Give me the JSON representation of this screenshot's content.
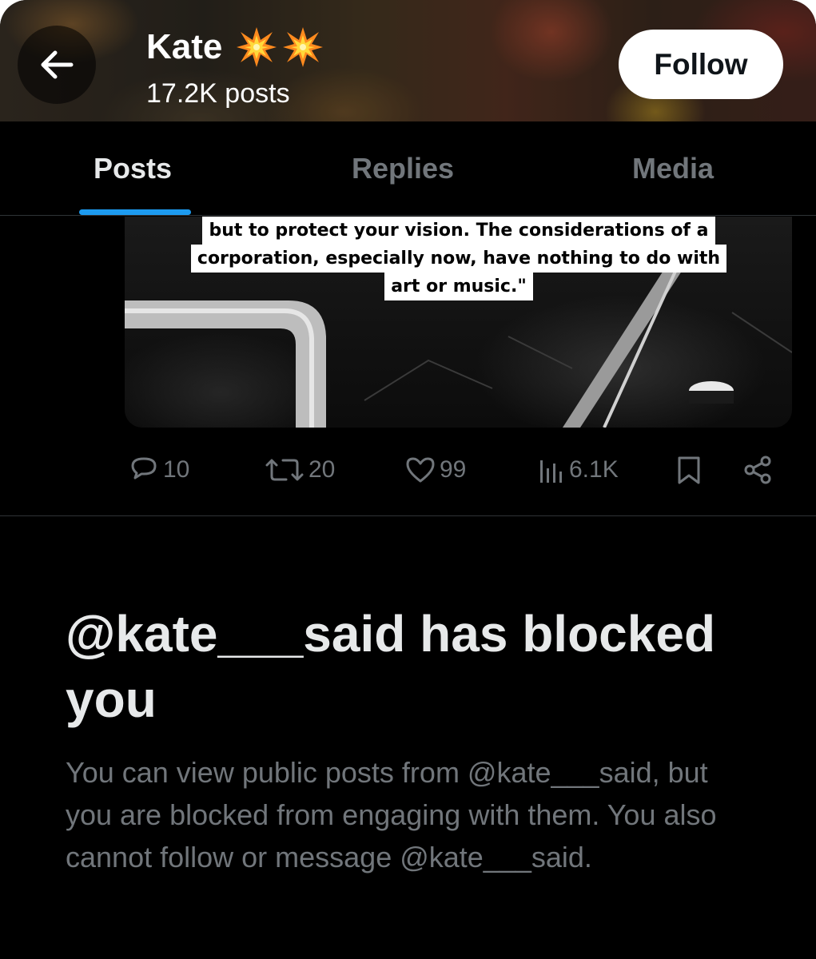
{
  "header": {
    "name": "Kate",
    "posts_count": "17.2K posts",
    "follow_label": "Follow"
  },
  "tabs": [
    {
      "label": "Posts",
      "active": true
    },
    {
      "label": "Replies",
      "active": false
    },
    {
      "label": "Media",
      "active": false
    }
  ],
  "post": {
    "image_caption_lines": [
      "but to protect your vision. The considerations of a",
      "corporation, especially now, have nothing to do with",
      "art or music.\""
    ],
    "actions": {
      "replies": "10",
      "reposts": "20",
      "likes": "99",
      "views": "6.1K"
    }
  },
  "blocked": {
    "title": "@kate___said has blocked you",
    "body": "You can view public posts from @kate___said, but you are blocked from engaging with them. You also cannot follow or message @kate___said."
  },
  "colors": {
    "accent": "#1d9bf0",
    "background": "#000000",
    "muted_text": "#71767b",
    "primary_text": "#e7e9ea"
  },
  "icons": [
    "back-arrow-icon",
    "collision-emoji-icon",
    "reply-icon",
    "repost-icon",
    "like-icon",
    "views-icon",
    "bookmark-icon",
    "share-icon"
  ]
}
